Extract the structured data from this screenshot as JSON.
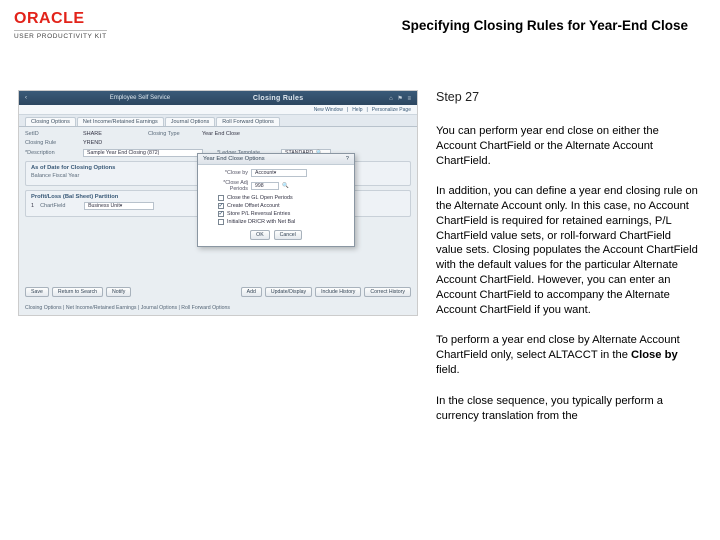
{
  "header": {
    "brand": "ORACLE",
    "product_line": "USER PRODUCTIVITY KIT",
    "title": "Specifying Closing Rules for Year-End Close"
  },
  "step": {
    "label": "Step 27"
  },
  "body": {
    "p1": "You can perform year end close on either the Account ChartField or the Alternate Account ChartField.",
    "p2": "In addition, you can define a year end closing rule on the Alternate Account only. In this case, no Account ChartField is required for retained earnings, P/L ChartField value sets, or roll-forward ChartField value sets. Closing populates the Account ChartField with the default values for the particular Alternate Account ChartField. However, you can enter an Account ChartField to accompany the Alternate Account ChartField if you want.",
    "p3_pre": "To perform a year end close by Alternate Account ChartField only, select ALTACCT in the ",
    "p3_bold": "Close by",
    "p3_post": " field.",
    "p4": "In the close sequence, you typically perform a currency translation from the"
  },
  "app": {
    "topbar": {
      "back": "‹",
      "section": "Employee Self Service",
      "title": "Closing Rules"
    },
    "subbar": {
      "a": "New Window",
      "b": "Help",
      "c": "Personalize Page"
    },
    "tabs": {
      "t1": "Closing Options",
      "t2": "Net Income/Retained Earnings",
      "t3": "Journal Options",
      "t4": "Roll Forward Options"
    },
    "fields": {
      "setid_lbl": "SetID",
      "setid_val": "SHARE",
      "rule_lbl": "Closing Rule",
      "rule_val": "YREND",
      "type_lbl": "Closing Type",
      "type_val": "Year End Close",
      "desc_lbl": "*Description",
      "desc_val": "Sample Year End Closing (872)",
      "ledger_lbl": "*Ledger Template",
      "ledger_val": "STANDARD"
    },
    "sec1": {
      "title": "As of Date for Closing Options",
      "lbl": "Balance Fiscal Year"
    },
    "sec2": {
      "title": "Profit/Loss (Bal Sheet) Partition",
      "row": "1",
      "cf": "ChartField",
      "val": "Business Unit"
    },
    "dialog": {
      "title": "Year End Close Options",
      "closeby_lbl": "*Close by",
      "closeby_val": "Account",
      "adj_lbl": "*Close Adj Periods",
      "adj_sel": "998",
      "c1": "Close the GL Open Periods",
      "c2": "Create Offset Account",
      "c3": "Store P/L Reversal Entries",
      "c4": "Initialize DR/CR with Net Bal",
      "ok": "OK",
      "cancel": "Cancel"
    },
    "buttons": {
      "save": "Save",
      "return": "Return to Search",
      "notify": "Notify",
      "add": "Add",
      "upd": "Update/Display",
      "inc": "Include History",
      "corr": "Correct History"
    },
    "footnote": "Closing Options | Net Income/Retained Earnings | Journal Options | Roll Forward Options"
  }
}
